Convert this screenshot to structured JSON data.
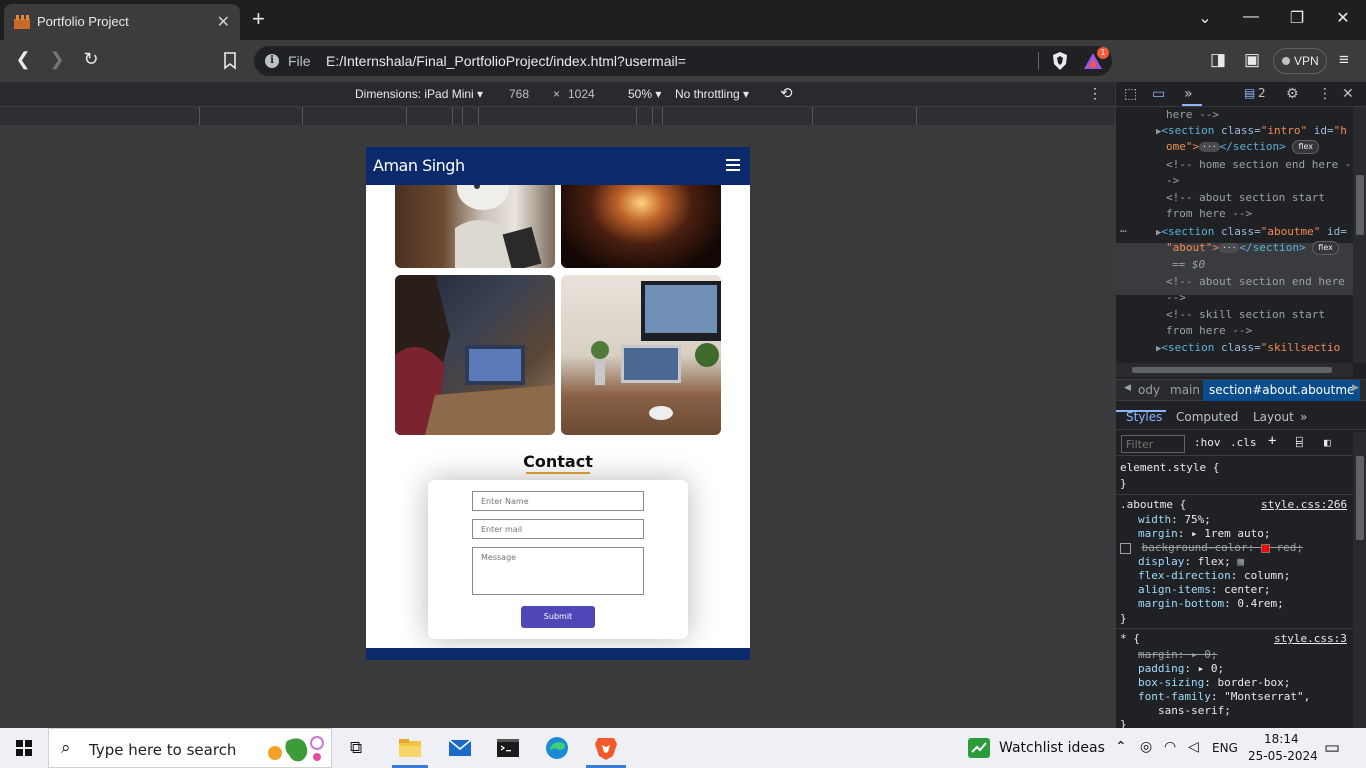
{
  "browser": {
    "tab_title": "Portfolio Project",
    "address": {
      "scheme_label": "File",
      "url": "E:/Internshala/Final_PortfolioProject/index.html?usermail="
    },
    "rewards_badge": "1",
    "vpn_label": "VPN"
  },
  "device_toolbar": {
    "dimensions_label": "Dimensions: iPad Mini",
    "width_value": "768",
    "height_value": "1024",
    "zoom": "50%",
    "throttling": "No throttling"
  },
  "site": {
    "logo": "Aman Singh",
    "contact_title": "Contact",
    "form": {
      "name_placeholder": "Enter Name",
      "mail_placeholder": "Enter mail",
      "message_placeholder": "Message",
      "submit_label": "Submit"
    },
    "colors": {
      "nav": "#0a2a6b",
      "submit": "#4f47b8",
      "accent": "#e5a631"
    }
  },
  "devtools": {
    "issues_count": "2",
    "dom": {
      "l1": "here -->",
      "l2_tag": "<section",
      "l2_attr": "class=",
      "l2_val": "\"intro\"",
      "l2_attr2": "id=",
      "l2_val2": "\"h",
      "l3_val": "ome\">",
      "l3_close": "</section>",
      "flex": "flex",
      "c1": "<!-- home section end here -",
      "c1b": "->",
      "c2": "<!-- about section start",
      "c2b": "from here -->",
      "l4_tag": "<section",
      "l4_attr": "class=",
      "l4_val": "\"aboutme\"",
      "l4_attr2": "id=",
      "l5_val": "\"about\">",
      "l5_close": "</section>",
      "eq": "== $0",
      "c3": "<!-- about section end here",
      "c3b": "-->",
      "c4": "<!-- skill section start",
      "c4b": "from here -->",
      "l6_tag": "<section",
      "l6_attr": "class=",
      "l6_val": "\"skillsectio"
    },
    "breadcrumbs": [
      "ody",
      "main",
      "section#about.aboutme"
    ],
    "style_tabs": [
      "Styles",
      "Computed",
      "Layout"
    ],
    "filter_placeholder": "Filter",
    "hov": ":hov",
    "cls": ".cls",
    "styles": {
      "element_style": "element.style {",
      "close": "}",
      "rule1_selector": ".aboutme {",
      "rule1_source": "style.css:266",
      "rule1_props": [
        {
          "name": "width",
          "value": "75%;"
        },
        {
          "name": "margin",
          "value": "1rem auto;"
        },
        {
          "name": "background-color",
          "value": "red;"
        },
        {
          "name": "display",
          "value": "flex;"
        },
        {
          "name": "flex-direction",
          "value": "column;"
        },
        {
          "name": "align-items",
          "value": "center;"
        },
        {
          "name": "margin-bottom",
          "value": "0.4rem;"
        }
      ],
      "rule2_selector": "* {",
      "rule2_source": "style.css:3",
      "rule2_props": [
        {
          "name": "margin",
          "value": "0;"
        },
        {
          "name": "padding",
          "value": "0;"
        },
        {
          "name": "box-sizing",
          "value": "border-box;"
        },
        {
          "name": "font-family",
          "value": "\"Montserrat\","
        },
        {
          "name": "",
          "value": "sans-serif;"
        }
      ]
    }
  },
  "taskbar": {
    "search_placeholder": "Type here to search",
    "watchlist": "Watchlist ideas",
    "lang": "ENG",
    "time": "18:14",
    "date": "25-05-2024"
  }
}
